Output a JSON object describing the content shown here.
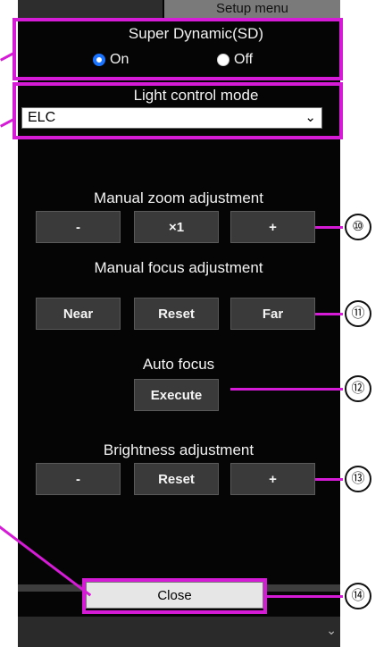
{
  "header": {
    "setup_menu_label": "Setup menu"
  },
  "super_dynamic": {
    "title": "Super Dynamic(SD)",
    "on_label": "On",
    "off_label": "Off",
    "selected": "On"
  },
  "light_control": {
    "title": "Light control mode",
    "selected_value": "ELC"
  },
  "zoom": {
    "title": "Manual zoom adjustment",
    "minus_label": "-",
    "x1_label": "×1",
    "plus_label": "+"
  },
  "focus": {
    "title": "Manual focus adjustment",
    "near_label": "Near",
    "reset_label": "Reset",
    "far_label": "Far"
  },
  "auto_focus": {
    "title": "Auto focus",
    "execute_label": "Execute"
  },
  "brightness": {
    "title": "Brightness adjustment",
    "minus_label": "-",
    "reset_label": "Reset",
    "plus_label": "+"
  },
  "close": {
    "label": "Close"
  },
  "callouts": {
    "zoom": "⑩",
    "focus": "⑪",
    "auto_focus": "⑫",
    "brightness": "⑬",
    "close": "⑭"
  },
  "colors": {
    "panel_bg": "#050505",
    "highlight": "#d51bd6",
    "button_dark": "#3a3a3a",
    "button_light": "#e6e6e6",
    "radio_accent": "#1a74ff"
  }
}
